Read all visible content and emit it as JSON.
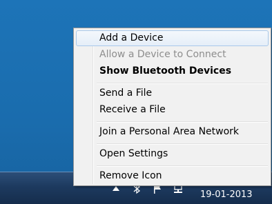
{
  "menu": {
    "items": [
      {
        "label": "Add a Device",
        "state": "hover"
      },
      {
        "label": "Allow a Device to Connect",
        "state": "disabled"
      },
      {
        "label": "Show Bluetooth Devices",
        "state": "default-bold"
      },
      {
        "label": "Send a File",
        "state": "normal"
      },
      {
        "label": "Receive a File",
        "state": "normal"
      },
      {
        "label": "Join a Personal Area Network",
        "state": "normal"
      },
      {
        "label": "Open Settings",
        "state": "normal"
      },
      {
        "label": "Remove Icon",
        "state": "normal"
      }
    ]
  },
  "taskbar": {
    "clock_date": "19-01-2013",
    "tray_icons": [
      "show-hidden-icons-arrow",
      "bluetooth-icon",
      "action-center-flag-icon",
      "network-icon"
    ]
  },
  "colors": {
    "desktop": "#1b6fb0",
    "menu_bg": "#f1f1f1",
    "hover_border": "#a8c8ea",
    "disabled_text": "#8d8d8d"
  }
}
